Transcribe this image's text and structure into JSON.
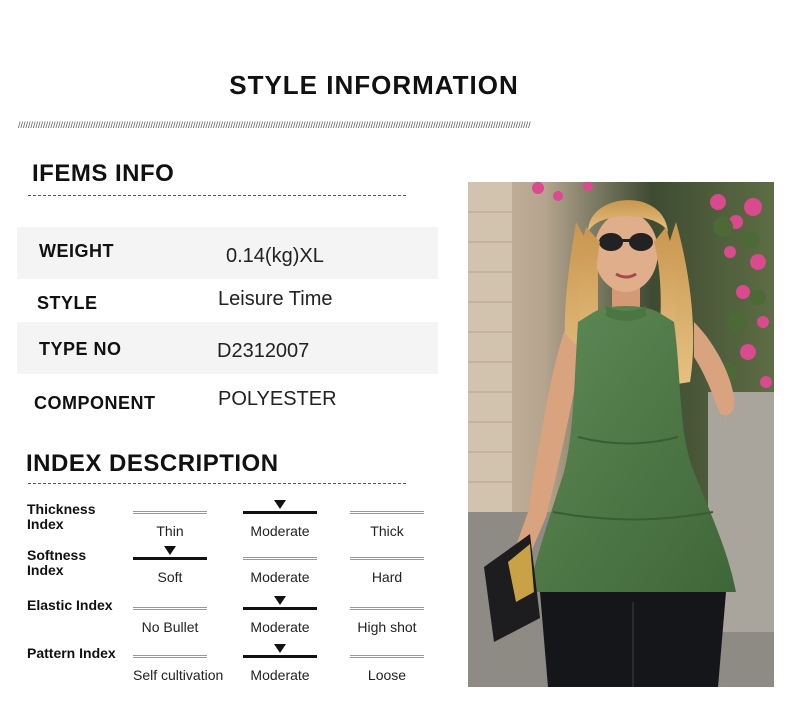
{
  "header": {
    "title": "STYLE INFORMATION"
  },
  "items_info": {
    "heading": "IFEMS INFO",
    "rows": [
      {
        "key": "WEIGHT",
        "value": "0.14(kg)XL"
      },
      {
        "key": "STYLE",
        "value": "Leisure Time"
      },
      {
        "key": "TYPE NO",
        "value": "D2312007"
      },
      {
        "key": "COMPONENT",
        "value": "POLYESTER"
      }
    ]
  },
  "index": {
    "heading": "INDEX DESCRIPTION",
    "rows": [
      {
        "label": "Thickness Index",
        "options": [
          "Thin",
          "Moderate",
          "Thick"
        ],
        "selected": 1
      },
      {
        "label": "Softness Index",
        "options": [
          "Soft",
          "Moderate",
          "Hard"
        ],
        "selected": 0
      },
      {
        "label": "Elastic Index",
        "options": [
          "No Bullet",
          "Moderate",
          "High shot"
        ],
        "selected": 1
      },
      {
        "label": "Pattern Index",
        "options": [
          "Self cultivation",
          "Moderate",
          "Loose"
        ],
        "selected": 1
      }
    ]
  },
  "colors": {
    "top": "#4f7a45",
    "pants": "#15161a",
    "hair": "#d8ad68"
  }
}
